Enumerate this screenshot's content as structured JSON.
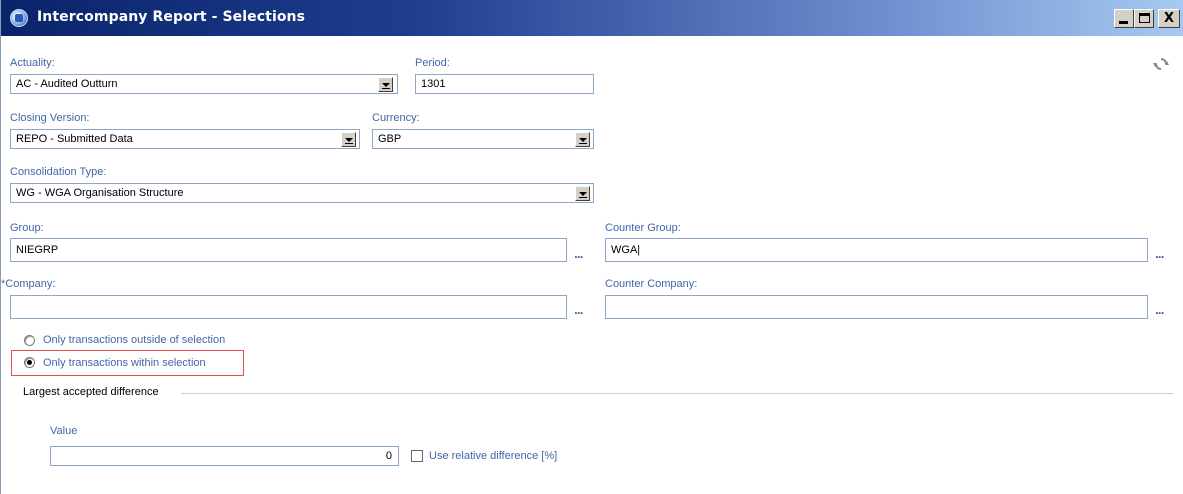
{
  "window": {
    "title": "Intercompany Report - Selections",
    "controls": {
      "minimize": "_",
      "maximize": "□",
      "close": "X"
    }
  },
  "form": {
    "actuality": {
      "label": "Actuality:",
      "value": "AC - Audited Outturn"
    },
    "period": {
      "label": "Period:",
      "value": "1301"
    },
    "closing_version": {
      "label": "Closing Version:",
      "value": "REPO - Submitted Data"
    },
    "currency": {
      "label": "Currency:",
      "value": "GBP"
    },
    "consolidation_type": {
      "label": "Consolidation Type:",
      "value": "WG - WGA Organisation Structure"
    },
    "group": {
      "label": "Group:",
      "value": "NIEGRP",
      "browse": "..."
    },
    "counter_group": {
      "label": "Counter Group:",
      "value": "WGA|",
      "browse": "..."
    },
    "company": {
      "required_mark": "*",
      "label": "Company:",
      "value": "",
      "browse": "..."
    },
    "counter_company": {
      "label": "Counter Company:",
      "value": "",
      "browse": "..."
    },
    "radio_options": [
      {
        "label": "Only transactions outside of selection",
        "checked": false
      },
      {
        "label": "Only transactions within selection",
        "checked": true
      }
    ],
    "difference_group": {
      "title": "Largest accepted difference",
      "value_label": "Value",
      "value": "0",
      "relative_label": "Use relative difference [%]",
      "relative_checked": false
    }
  },
  "icons": {
    "refresh": "refresh-icon",
    "app": "app-icon"
  },
  "colors": {
    "titlebar_start": "#0a246a",
    "titlebar_end": "#a6caf0",
    "label": "#4166a8",
    "highlight": "#e05050"
  }
}
